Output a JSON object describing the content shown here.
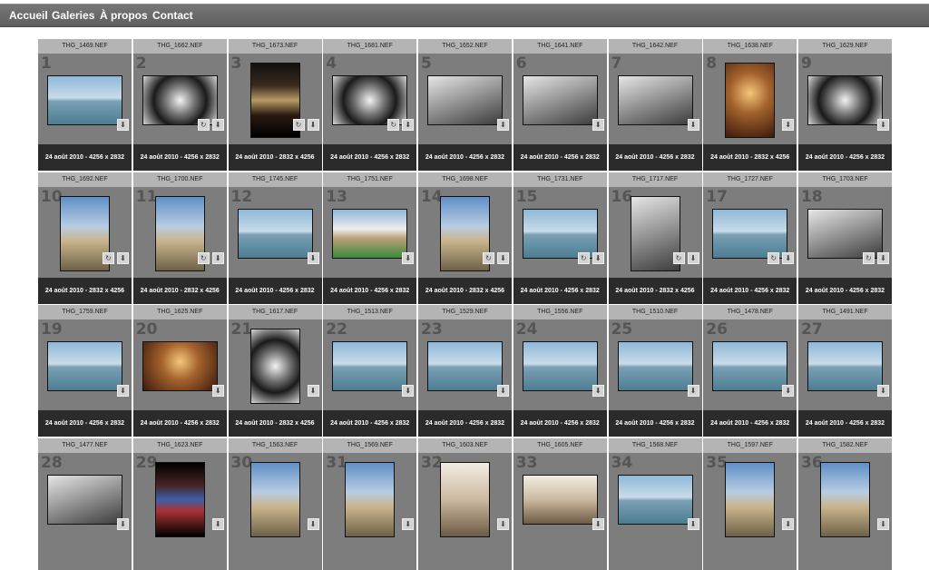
{
  "nav": {
    "items": [
      "Accueil",
      "Galeries",
      "À propos",
      "Contact"
    ]
  },
  "icons": {
    "download": "download-icon",
    "rotate": "rotate-icon"
  },
  "photos": [
    {
      "file": "THG_1469.NEF",
      "num": "1",
      "caption": "24 août 2010 - 4256 x 2832",
      "orient": "land",
      "theme": "sea",
      "rot": false
    },
    {
      "file": "THG_1662.NEF",
      "num": "2",
      "caption": "24 août 2010 - 4256 x 2832",
      "orient": "land",
      "theme": "stair",
      "rot": true
    },
    {
      "file": "THG_1673.NEF",
      "num": "3",
      "caption": "24 août 2010 - 2832 x 4256",
      "orient": "port",
      "theme": "dark",
      "rot": true
    },
    {
      "file": "THG_1681.NEF",
      "num": "4",
      "caption": "24 août 2010 - 4256 x 2832",
      "orient": "land",
      "theme": "stair",
      "rot": true
    },
    {
      "file": "THG_1652.NEF",
      "num": "5",
      "caption": "24 août 2010 - 4256 x 2832",
      "orient": "land",
      "theme": "gray",
      "rot": false
    },
    {
      "file": "THG_1641.NEF",
      "num": "6",
      "caption": "24 août 2010 - 4256 x 2832",
      "orient": "land",
      "theme": "gray",
      "rot": false
    },
    {
      "file": "THG_1642.NEF",
      "num": "7",
      "caption": "24 août 2010 - 4256 x 2832",
      "orient": "land",
      "theme": "gray",
      "rot": false
    },
    {
      "file": "THG_1638.NEF",
      "num": "8",
      "caption": "24 août 2010 - 2832 x 4256",
      "orient": "port",
      "theme": "warm",
      "rot": false
    },
    {
      "file": "THG_1629.NEF",
      "num": "9",
      "caption": "24 août 2010 - 4256 x 2832",
      "orient": "land",
      "theme": "stair",
      "rot": false
    },
    {
      "file": "THG_1692.NEF",
      "num": "10",
      "caption": "24 août 2010 - 2832 x 4256",
      "orient": "port",
      "theme": "tower",
      "rot": true
    },
    {
      "file": "THG_1700.NEF",
      "num": "11",
      "caption": "24 août 2010 - 2832 x 4256",
      "orient": "port",
      "theme": "tower",
      "rot": true
    },
    {
      "file": "THG_1745.NEF",
      "num": "12",
      "caption": "24 août 2010 - 4256 x 2832",
      "orient": "land",
      "theme": "sea",
      "rot": false
    },
    {
      "file": "THG_1751.NEF",
      "num": "13",
      "caption": "24 août 2010 - 4256 x 2832",
      "orient": "land",
      "theme": "people",
      "rot": false
    },
    {
      "file": "THG_1698.NEF",
      "num": "14",
      "caption": "24 août 2010 - 2832 x 4256",
      "orient": "port",
      "theme": "tower",
      "rot": true
    },
    {
      "file": "THG_1731.NEF",
      "num": "15",
      "caption": "24 août 2010 - 4256 x 2832",
      "orient": "land",
      "theme": "sea",
      "rot": true
    },
    {
      "file": "THG_1717.NEF",
      "num": "16",
      "caption": "24 août 2010 - 2832 x 4256",
      "orient": "port",
      "theme": "gray",
      "rot": true
    },
    {
      "file": "THG_1727.NEF",
      "num": "17",
      "caption": "24 août 2010 - 4256 x 2832",
      "orient": "land",
      "theme": "sea",
      "rot": true
    },
    {
      "file": "THG_1703.NEF",
      "num": "18",
      "caption": "24 août 2010 - 4256 x 2832",
      "orient": "land",
      "theme": "gray",
      "rot": true
    },
    {
      "file": "THG_1759.NEF",
      "num": "19",
      "caption": "24 août 2010 - 4256 x 2832",
      "orient": "land",
      "theme": "sea",
      "rot": false
    },
    {
      "file": "THG_1625.NEF",
      "num": "20",
      "caption": "24 août 2010 - 4256 x 2832",
      "orient": "land",
      "theme": "warm",
      "rot": false
    },
    {
      "file": "THG_1617.NEF",
      "num": "21",
      "caption": "24 août 2010 - 2832 x 4256",
      "orient": "port",
      "theme": "stair",
      "rot": false
    },
    {
      "file": "THG_1513.NEF",
      "num": "22",
      "caption": "24 août 2010 - 4256 x 2832",
      "orient": "land",
      "theme": "sea",
      "rot": false
    },
    {
      "file": "THG_1529.NEF",
      "num": "23",
      "caption": "24 août 2010 - 4256 x 2832",
      "orient": "land",
      "theme": "sea",
      "rot": false
    },
    {
      "file": "THG_1556.NEF",
      "num": "24",
      "caption": "24 août 2010 - 4256 x 2832",
      "orient": "land",
      "theme": "sea",
      "rot": false
    },
    {
      "file": "THG_1510.NEF",
      "num": "25",
      "caption": "24 août 2010 - 4256 x 2832",
      "orient": "land",
      "theme": "sea",
      "rot": false
    },
    {
      "file": "THG_1478.NEF",
      "num": "26",
      "caption": "24 août 2010 - 4256 x 2832",
      "orient": "land",
      "theme": "sea",
      "rot": false
    },
    {
      "file": "THG_1491.NEF",
      "num": "27",
      "caption": "24 août 2010 - 4256 x 2832",
      "orient": "land",
      "theme": "sea",
      "rot": false
    },
    {
      "file": "THG_1477.NEF",
      "num": "28",
      "caption": "",
      "orient": "land",
      "theme": "gray",
      "rot": false
    },
    {
      "file": "THG_1623.NEF",
      "num": "29",
      "caption": "",
      "orient": "port",
      "theme": "stain",
      "rot": false
    },
    {
      "file": "THG_1563.NEF",
      "num": "30",
      "caption": "",
      "orient": "port",
      "theme": "tower",
      "rot": false
    },
    {
      "file": "THG_1569.NEF",
      "num": "31",
      "caption": "",
      "orient": "port",
      "theme": "tower",
      "rot": false
    },
    {
      "file": "THG_1603.NEF",
      "num": "32",
      "caption": "",
      "orient": "port",
      "theme": "inter",
      "rot": false
    },
    {
      "file": "THG_1605.NEF",
      "num": "33",
      "caption": "",
      "orient": "land",
      "theme": "inter",
      "rot": false
    },
    {
      "file": "THG_1568.NEF",
      "num": "34",
      "caption": "",
      "orient": "land",
      "theme": "sea",
      "rot": false
    },
    {
      "file": "THG_1597.NEF",
      "num": "35",
      "caption": "",
      "orient": "port",
      "theme": "tower",
      "rot": false
    },
    {
      "file": "THG_1582.NEF",
      "num": "36",
      "caption": "",
      "orient": "port",
      "theme": "tower",
      "rot": false
    }
  ]
}
